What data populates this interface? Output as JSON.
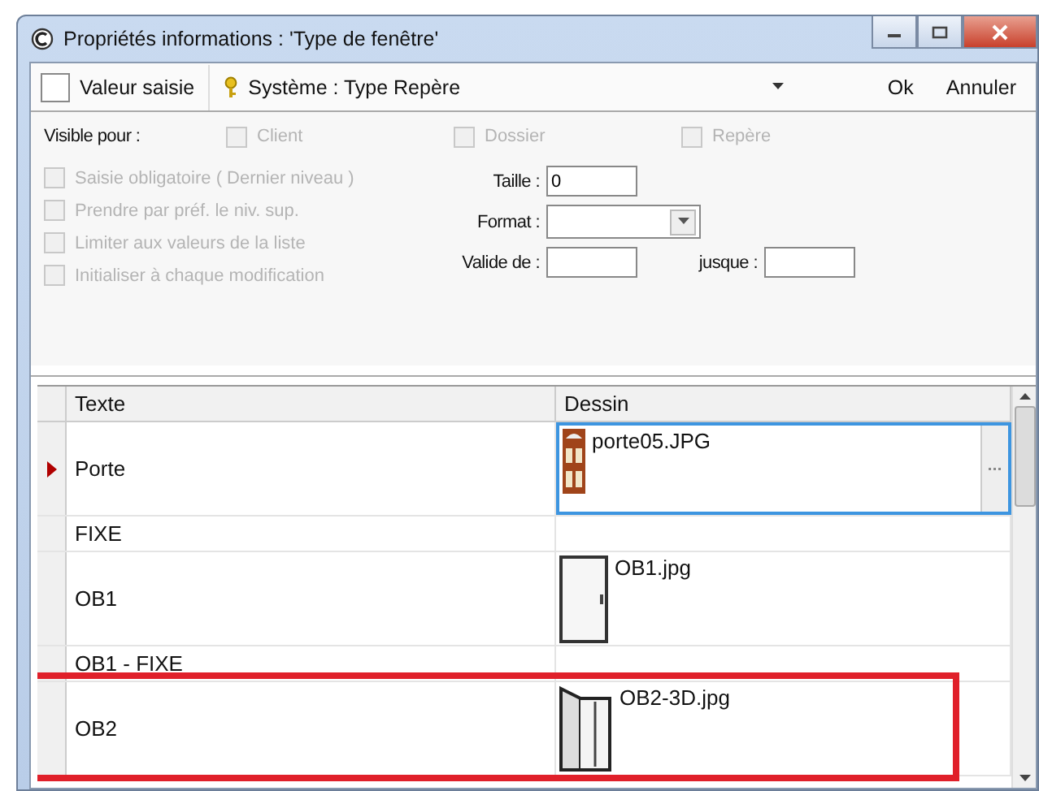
{
  "window": {
    "title": "Propriétés informations : 'Type de fenêtre'"
  },
  "toolbar": {
    "value_checkbox": {
      "label": "Valeur saisie",
      "checked": false
    },
    "system_dropdown": {
      "value": "Système : Type Repère"
    },
    "buttons": [
      "Ok",
      "Annuler"
    ]
  },
  "options": {
    "visible_label": "Visible pour :",
    "visible_for": [
      {
        "label": "Client",
        "checked": false,
        "disabled": true
      },
      {
        "label": "Dossier",
        "checked": false,
        "disabled": true
      },
      {
        "label": "Repère",
        "checked": false,
        "disabled": true
      }
    ],
    "checkboxes": [
      {
        "label": "Saisie obligatoire ( Dernier niveau )",
        "checked": false,
        "disabled": true
      },
      {
        "label": "Prendre par préf. le niv. sup.",
        "checked": false,
        "disabled": true
      },
      {
        "label": "Limiter aux valeurs de la liste",
        "checked": false,
        "disabled": true
      },
      {
        "label": "Initialiser à chaque modification",
        "checked": false,
        "disabled": true
      }
    ],
    "taille": {
      "label": "Taille :",
      "value": "0"
    },
    "format": {
      "label": "Format :"
    },
    "valide_de": {
      "label": "Valide de :"
    },
    "jusque": {
      "label": "jusque :"
    }
  },
  "table": {
    "columns": [
      "Texte",
      "Dessin"
    ],
    "rows": [
      {
        "text": "Porte",
        "selected": true,
        "highlighted": false,
        "image": {
          "kind": "brown-door",
          "file": "porte05.JPG"
        }
      },
      {
        "text": "FIXE",
        "selected": false,
        "highlighted": false
      },
      {
        "text": "OB1",
        "selected": false,
        "highlighted": false,
        "image": {
          "kind": "white-door",
          "file": "OB1.jpg"
        }
      },
      {
        "text": "OB1 - FIXE",
        "selected": false,
        "highlighted": false
      },
      {
        "text": "OB2",
        "selected": false,
        "highlighted": true,
        "image": {
          "kind": "open-door",
          "file": "OB2-3D.jpg"
        }
      }
    ]
  }
}
